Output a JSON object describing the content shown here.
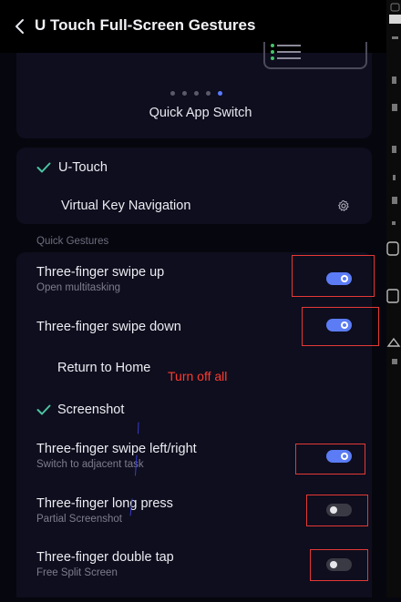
{
  "header": {
    "title": "U Touch Full-Screen Gestures",
    "back_icon": "chevron-left-icon"
  },
  "carousel": {
    "caption": "Quick App Switch",
    "page_count": 5,
    "active_index": 4
  },
  "mode_card": {
    "selected_label": "U-Touch",
    "virtual_key_label": "Virtual Key Navigation",
    "settings_icon": "gear-icon"
  },
  "quick_gestures": {
    "section_label": "Quick Gestures",
    "swipe_up": {
      "title": "Three-finger swipe up",
      "subtitle": "Open multitasking",
      "enabled": true
    },
    "swipe_down": {
      "title": "Three-finger swipe down",
      "enabled": true,
      "options": [
        {
          "label": "Return to Home",
          "selected": false
        },
        {
          "label": "Screenshot",
          "selected": true
        }
      ]
    },
    "swipe_left_right": {
      "title": "Three-finger swipe left/right",
      "subtitle": "Switch to adjacent task",
      "enabled": true
    },
    "long_press": {
      "title": "Three-finger long press",
      "subtitle": "Partial Screenshot",
      "enabled": false
    },
    "double_tap": {
      "title": "Three-finger double tap",
      "subtitle": "Free Split Screen",
      "enabled": false
    }
  },
  "annotation": {
    "text": "Turn off all",
    "color": "#ff3b30"
  },
  "colors": {
    "accent": "#5b7cf5",
    "check": "#4cc3a0",
    "background": "#06060e"
  }
}
